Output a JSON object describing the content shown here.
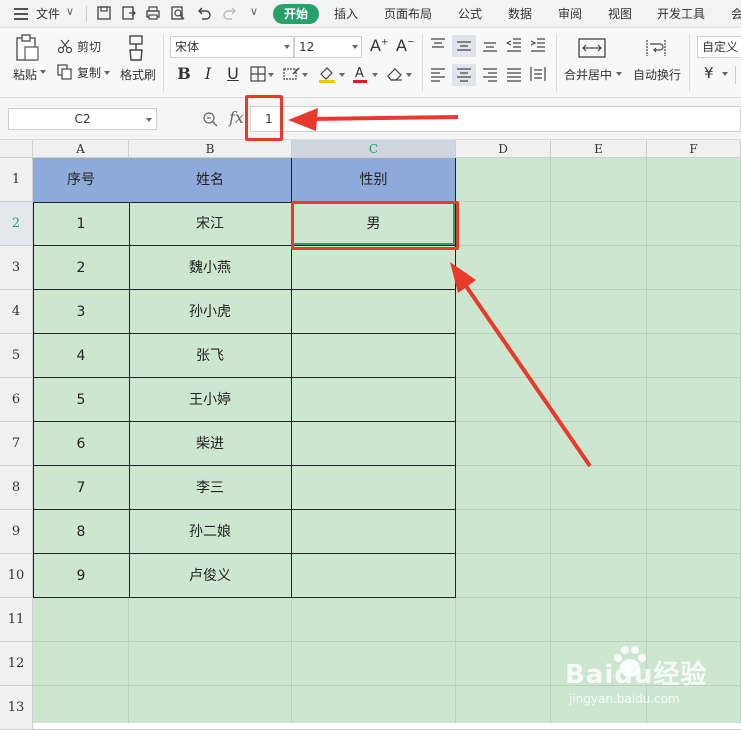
{
  "menubar": {
    "file_label": "文件",
    "tabs": [
      {
        "label": "开始",
        "active": true
      },
      {
        "label": "插入",
        "active": false
      },
      {
        "label": "页面布局",
        "active": false
      },
      {
        "label": "公式",
        "active": false
      },
      {
        "label": "数据",
        "active": false
      },
      {
        "label": "审阅",
        "active": false
      },
      {
        "label": "视图",
        "active": false
      },
      {
        "label": "开发工具",
        "active": false
      },
      {
        "label": "会",
        "active": false
      }
    ]
  },
  "ribbon": {
    "paste_label": "粘贴",
    "cut_label": "剪切",
    "copy_label": "复制",
    "format_painter_label": "格式刷",
    "font_name": "宋体",
    "font_size": "12",
    "merge_label": "合并居中",
    "wrap_label": "自动换行",
    "number_format": "自定义",
    "currency_symbol": "¥"
  },
  "formula_bar": {
    "name_box": "C2",
    "fx_label": "fx",
    "value": "1"
  },
  "sheet": {
    "columns": [
      "A",
      "B",
      "C",
      "D",
      "E",
      "F"
    ],
    "rows": [
      "1",
      "2",
      "3",
      "4",
      "5",
      "6",
      "7",
      "8",
      "9",
      "10",
      "11",
      "12",
      "13"
    ],
    "selected_column": "C",
    "selected_row": "2",
    "headers": [
      "序号",
      "姓名",
      "性别"
    ],
    "data": [
      [
        "1",
        "宋江",
        "男"
      ],
      [
        "2",
        "魏小燕",
        ""
      ],
      [
        "3",
        "孙小虎",
        ""
      ],
      [
        "4",
        "张飞",
        ""
      ],
      [
        "5",
        "王小婷",
        ""
      ],
      [
        "6",
        "柴进",
        ""
      ],
      [
        "7",
        "李三",
        ""
      ],
      [
        "8",
        "孙二娘",
        ""
      ],
      [
        "9",
        "卢俊义",
        ""
      ]
    ]
  },
  "watermark": {
    "text": "Baidu经验",
    "sub": "jingyan.baidu.com"
  },
  "colors": {
    "accent": "#28a06b",
    "header_fill": "#8eaadb",
    "sheet_bg": "#cde6cf",
    "annotation": "#e83a2c"
  }
}
